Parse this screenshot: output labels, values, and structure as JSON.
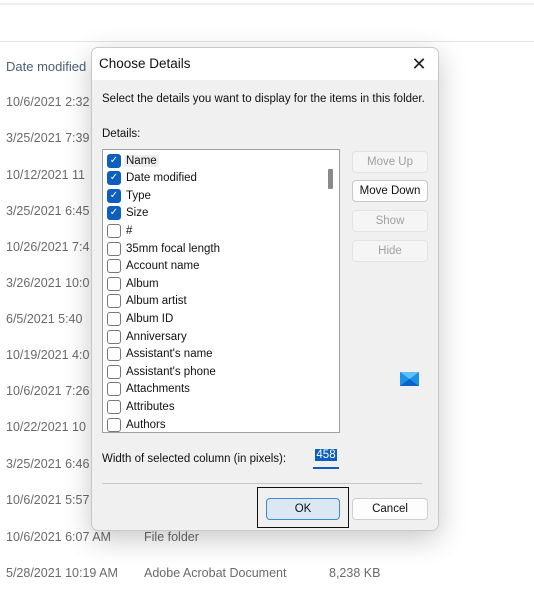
{
  "explorer": {
    "column_header": "Date modified",
    "rows": [
      {
        "date": "10/6/2021 2:32",
        "type": "",
        "size": ""
      },
      {
        "date": "3/25/2021 7:39",
        "type": "",
        "size": ""
      },
      {
        "date": "10/12/2021 11",
        "type": "",
        "size": ""
      },
      {
        "date": "3/25/2021 6:45",
        "type": "",
        "size": ""
      },
      {
        "date": "10/26/2021 7:4",
        "type": "",
        "size": ""
      },
      {
        "date": "3/26/2021 10:0",
        "type": "",
        "size": ""
      },
      {
        "date": "6/5/2021 5:40",
        "type": "",
        "size": ""
      },
      {
        "date": "10/19/2021 4:0",
        "type": "",
        "size": ""
      },
      {
        "date": "10/6/2021 7:26",
        "type": "",
        "size": ""
      },
      {
        "date": "10/22/2021 10",
        "type": "",
        "size": ""
      },
      {
        "date": "3/25/2021 6:46",
        "type": "",
        "size": ""
      },
      {
        "date": "10/6/2021 5:57",
        "type": "",
        "size": ""
      },
      {
        "date": "10/6/2021 6:07 AM",
        "type": "File folder",
        "size": ""
      },
      {
        "date": "5/28/2021 10:19 AM",
        "type": "Adobe Acrobat Document",
        "size": "8,238 KB"
      }
    ]
  },
  "dialog": {
    "title": "Choose Details",
    "close_icon": "close-icon",
    "instruction": "Select the details you want to display for the items in this folder.",
    "details_label": "Details:",
    "items": [
      {
        "label": "Name",
        "checked": true
      },
      {
        "label": "Date modified",
        "checked": true
      },
      {
        "label": "Type",
        "checked": true
      },
      {
        "label": "Size",
        "checked": true
      },
      {
        "label": "#",
        "checked": false
      },
      {
        "label": "35mm focal length",
        "checked": false
      },
      {
        "label": "Account name",
        "checked": false
      },
      {
        "label": "Album",
        "checked": false
      },
      {
        "label": "Album artist",
        "checked": false
      },
      {
        "label": "Album ID",
        "checked": false
      },
      {
        "label": "Anniversary",
        "checked": false
      },
      {
        "label": "Assistant's name",
        "checked": false
      },
      {
        "label": "Assistant's phone",
        "checked": false
      },
      {
        "label": "Attachments",
        "checked": false
      },
      {
        "label": "Attributes",
        "checked": false
      },
      {
        "label": "Authors",
        "checked": false
      }
    ],
    "buttons": {
      "move_up": "Move Up",
      "move_down": "Move Down",
      "show": "Show",
      "hide": "Hide"
    },
    "width_label": "Width of selected column (in pixels):",
    "width_value": "458",
    "ok": "OK",
    "cancel": "Cancel",
    "accent": "#0d5ebf"
  }
}
